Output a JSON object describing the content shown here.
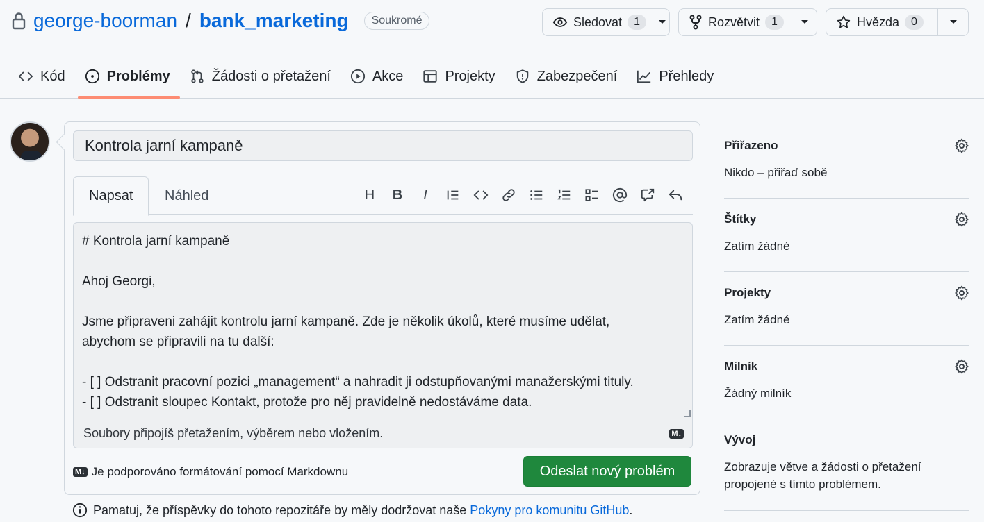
{
  "repo": {
    "owner": "george-boorman",
    "separator": "/",
    "name": "bank_marketing",
    "visibility": "Soukromé"
  },
  "actions": {
    "watch": {
      "label": "Sledovat",
      "count": "1"
    },
    "fork": {
      "label": "Rozvětvit",
      "count": "1"
    },
    "star": {
      "label": "Hvězda",
      "count": "0"
    }
  },
  "tabs": [
    {
      "label": "Kód",
      "icon": "code-icon"
    },
    {
      "label": "Problémy",
      "icon": "issue-icon",
      "active": true
    },
    {
      "label": "Žádosti o přetažení",
      "icon": "pull-request-icon"
    },
    {
      "label": "Akce",
      "icon": "play-icon"
    },
    {
      "label": "Projekty",
      "icon": "table-icon"
    },
    {
      "label": "Zabezpečení",
      "icon": "shield-icon"
    },
    {
      "label": "Přehledy",
      "icon": "graph-icon"
    }
  ],
  "issue_form": {
    "title_value": "Kontrola jarní kampaně",
    "write_tab": "Napsat",
    "preview_tab": "Náhled",
    "toolbar": [
      "H",
      "B",
      "I"
    ],
    "body_value": "# Kontrola jarní kampaně\n\nAhoj Georgi,\n\nJsme připraveni zahájit kontrolu jarní kampaně. Zde je několik úkolů, které musíme udělat,\nabychom se připravili na tu další:\n\n- [ ] Odstranit pracovní pozici „management“ a nahradit ji odstupňovanými manažerskými tituly.\n- [ ] Odstranit sloupec Kontakt, protože pro něj pravidelně nedostáváme data.",
    "drop_hint": "Soubory připojíš přetažením, výběrem nebo vložením.",
    "md_badge": "M↓",
    "markdown_note": "Je podporováno formátování pomocí Markdownu",
    "submit_label": "Odeslat nový problém"
  },
  "footer": {
    "prefix": "Pamatuj, že příspěvky do tohoto repozitáře by měly dodržovat naše ",
    "link": "Pokyny pro komunitu GitHub",
    "suffix": "."
  },
  "sidebar": [
    {
      "title": "Přiřazeno",
      "value": "Nikdo – přiřaď sobě",
      "gear": true
    },
    {
      "title": "Štítky",
      "value": "Zatím žádné",
      "gear": true
    },
    {
      "title": "Projekty",
      "value": "Zatím žádné",
      "gear": true
    },
    {
      "title": "Milník",
      "value": "Žádný milník",
      "gear": true
    },
    {
      "title": "Vývoj",
      "value": "Zobrazuje větve a žádosti o přetažení propojené s tímto problémem.",
      "gear": false
    }
  ],
  "colors": {
    "link": "#0969da",
    "primary_button": "#1f883d",
    "tab_underline": "#fd8c73"
  }
}
